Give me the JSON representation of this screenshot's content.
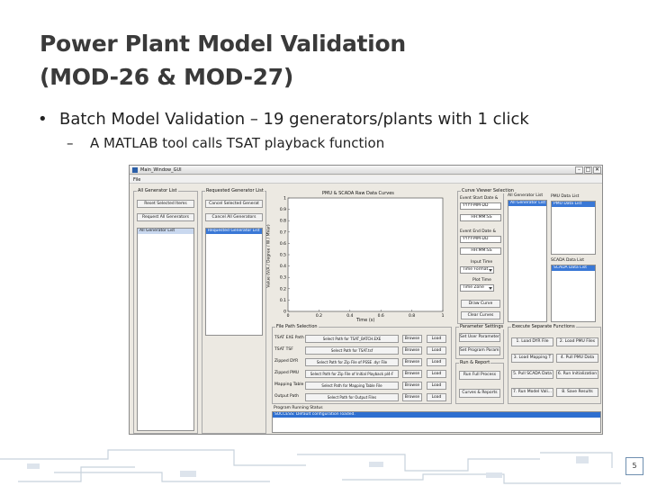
{
  "slide": {
    "title_line1": "Power Plant Model Validation",
    "title_line2": "(MOD-26 & MOD-27)",
    "bullet1": "Batch Model Validation – 19 generators/plants with 1 click",
    "bullet2": "A MATLAB tool calls TSAT playback function",
    "bullet_dot": "•",
    "sub_dash": "–",
    "page_number": "5"
  },
  "window": {
    "title": "Main_Window_GUI",
    "menu": "File",
    "minimize": "–",
    "maximize": "□",
    "close": "✕"
  },
  "generator_list": {
    "label": "All Generator List",
    "reset_button": "Reset Selected Items",
    "request_button": "Request All Generators",
    "list_item": "All Generator List"
  },
  "requested_list": {
    "label": "Requested Generator List",
    "cancel_selected_button": "Cancel Selected Generat",
    "cancel_all_button": "Cancel All Generators",
    "list_item": "Requested Generator List"
  },
  "plot": {
    "title": "PMU & SCADA Raw Data Curves",
    "ylabel": "Value (V/A / Degree / W / MVar)",
    "xlabel": "Time (s)",
    "yticks": [
      "1",
      "0.9",
      "0.8",
      "0.7",
      "0.6",
      "0.5",
      "0.4",
      "0.3",
      "0.2",
      "0.1",
      "0"
    ],
    "xticks": [
      "0",
      "0.2",
      "0.4",
      "0.6",
      "0.8",
      "1"
    ]
  },
  "curve_viewer": {
    "label": "Curve Viewer Selection",
    "event_start_label": "Event Start Date &",
    "event_start_date": "YYYY-MM-DD",
    "event_start_time": "HH:MM:SS",
    "event_end_label": "Event End Date &",
    "event_end_date": "YYYY-MM-DD",
    "event_end_time": "HH:MM:SS",
    "input_time_label": "Input Time",
    "input_time_value": "Time Format",
    "plot_time_label": "Plot Time",
    "plot_time_value": "Time Zone",
    "draw_curve_button": "Draw Curve",
    "clear_curves_button": "Clear Curves",
    "all_generator_list_label": "All Generator List",
    "all_generator_list_item": "All Generator List"
  },
  "pmu_data": {
    "label": "PMU Data List",
    "item": "PMU Data List"
  },
  "scada_data": {
    "label": "SCADA Data List",
    "item": "SCADA Data List"
  },
  "file_path": {
    "label": "File Path Selection",
    "rows": [
      {
        "name": "TSAT EXE Path",
        "button": "Select Path for TSAT_BATCH.EXE",
        "browse": "Browse",
        "load": "Load"
      },
      {
        "name": "TSAT TSF",
        "button": "Select Path for TSAT.tsf",
        "browse": "Browse",
        "load": "Load"
      },
      {
        "name": "Zipped DYR",
        "button": "Select Path for Zip File of PSSE .dyr File",
        "browse": "Browse",
        "load": "Load"
      },
      {
        "name": "Zipped PMU",
        "button": "Select Path for Zip File of Initial Playback pl4-F",
        "browse": "Browse",
        "load": "Load"
      },
      {
        "name": "Mapping Table",
        "button": "Select Path for Mapping Table File",
        "browse": "Browse",
        "load": "Load"
      },
      {
        "name": "Output Path",
        "button": "Select Path for Output Files",
        "browse": "Browse",
        "load": "Load"
      }
    ]
  },
  "parameter_settings": {
    "label": "Parameter Settings",
    "set_user_params": "Set User Parameters",
    "set_program_params": "Set Program Param..."
  },
  "run_report": {
    "label": "Run & Report",
    "run_full_process": "Run Full Process",
    "curves_reports": "Curves & Reports"
  },
  "execute_functions": {
    "label": "Execute Separate Functions",
    "buttons": [
      "1. Load DYR File",
      "2. Load PMU Files",
      "3. Load Mapping T",
      "4. Pull PMU Data",
      "5. Pull SCADA Data",
      "6. Run Initialization",
      "7. Run Model Vali...",
      "8. Save Results"
    ]
  },
  "status": {
    "label": "Program Running Status",
    "text": "SUCCESS: Default configuration loaded."
  }
}
